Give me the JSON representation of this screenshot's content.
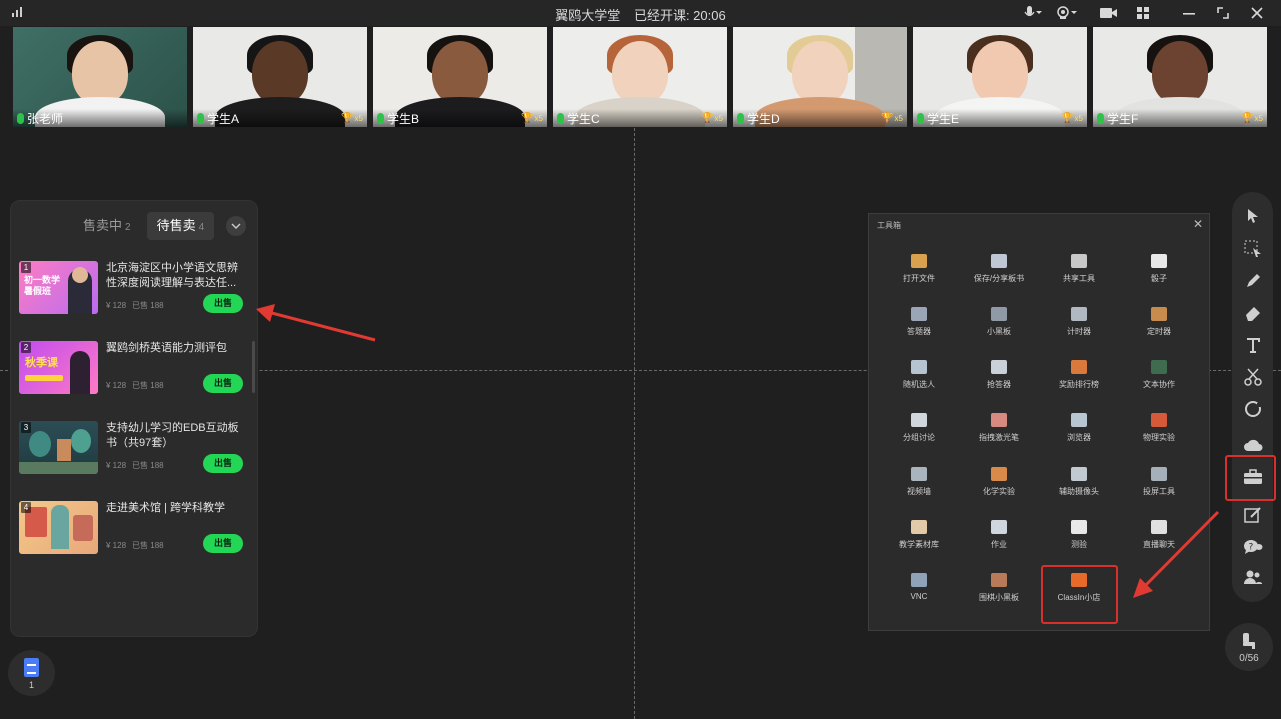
{
  "topbar": {
    "title": "翼鸥大学堂",
    "status": "已经开课: 20:06",
    "icons": [
      "signal-icon",
      "microphone-icon",
      "camera-select-icon",
      "video-icon",
      "layout-grid-icon",
      "minimize-icon",
      "restore-icon",
      "close-icon"
    ]
  },
  "videos": [
    {
      "name": "张老师",
      "trophy": ""
    },
    {
      "name": "学生A",
      "trophy": "x5"
    },
    {
      "name": "学生B",
      "trophy": "x5"
    },
    {
      "name": "学生C",
      "trophy": "x5"
    },
    {
      "name": "学生D",
      "trophy": "x5"
    },
    {
      "name": "学生E",
      "trophy": "x5"
    },
    {
      "name": "学生F",
      "trophy": "x5"
    }
  ],
  "shop": {
    "tabs": [
      {
        "label": "售卖中",
        "count": "2"
      },
      {
        "label": "待售卖",
        "count": "4"
      }
    ],
    "items": [
      {
        "index": "1",
        "title": "北京海淀区中小学语文思辨性深度阅读理解与表达任...",
        "price": "¥ 128",
        "sold": "已售 188",
        "button": "出售",
        "thumb_text": "初一数学 暑假班"
      },
      {
        "index": "2",
        "title": "翼鸥剑桥英语能力测评包",
        "price": "¥ 128",
        "sold": "已售 188",
        "button": "出售",
        "thumb_text": "秋季课"
      },
      {
        "index": "3",
        "title": "支持幼儿学习的EDB互动板书（共97套）",
        "price": "¥ 128",
        "sold": "已售 188",
        "button": "出售",
        "thumb_text": ""
      },
      {
        "index": "4",
        "title": "走进美术馆 | 跨学科教学",
        "price": "¥ 128",
        "sold": "已售 188",
        "button": "出售",
        "thumb_text": ""
      }
    ]
  },
  "doc_button": {
    "count": "1"
  },
  "toolbox": {
    "title": "工具箱",
    "close": "✕",
    "tools": [
      {
        "label": "打开文件",
        "icon": "folder-icon",
        "color": "#d9a04e"
      },
      {
        "label": "保存/分享板书",
        "icon": "save-icon",
        "color": "#bfc7d4"
      },
      {
        "label": "共享工具",
        "icon": "share-screen-icon",
        "color": "#c8c8c8"
      },
      {
        "label": "骰子",
        "icon": "dice-icon",
        "color": "#e8e8e8"
      },
      {
        "label": "答题器",
        "icon": "answer-icon",
        "color": "#9aa6b5"
      },
      {
        "label": "小黑板",
        "icon": "blackboard-icon",
        "color": "#8f9aa6"
      },
      {
        "label": "计时器",
        "icon": "stopwatch-icon",
        "color": "#b0b8c2"
      },
      {
        "label": "定时器",
        "icon": "hourglass-icon",
        "color": "#c78b4e"
      },
      {
        "label": "随机选人",
        "icon": "random-pick-icon",
        "color": "#b5c4d0"
      },
      {
        "label": "抢答器",
        "icon": "buzzer-icon",
        "color": "#c9d0d8"
      },
      {
        "label": "奖励排行榜",
        "icon": "leaderboard-icon",
        "color": "#d97a3c"
      },
      {
        "label": "文本协作",
        "icon": "text-collab-icon",
        "color": "#3f6b4e"
      },
      {
        "label": "分组讨论",
        "icon": "group-discuss-icon",
        "color": "#d0d6dc"
      },
      {
        "label": "指拽激光笔",
        "icon": "laser-pointer-icon",
        "color": "#d98a80"
      },
      {
        "label": "浏览器",
        "icon": "browser-icon",
        "color": "#b8c6d2"
      },
      {
        "label": "物理实验",
        "icon": "magnet-icon",
        "color": "#d65a3a"
      },
      {
        "label": "视频墙",
        "icon": "video-wall-icon",
        "color": "#aab4be"
      },
      {
        "label": "化学实验",
        "icon": "flask-icon",
        "color": "#d88a4a"
      },
      {
        "label": "辅助摄像头",
        "icon": "aux-camera-icon",
        "color": "#c2c9d0"
      },
      {
        "label": "投屏工具",
        "icon": "cast-icon",
        "color": "#a6b0ba"
      },
      {
        "label": "教学素材库",
        "icon": "material-library-icon",
        "color": "#e2c9a8"
      },
      {
        "label": "作业",
        "icon": "homework-icon",
        "color": "#cfd6de"
      },
      {
        "label": "测验",
        "icon": "quiz-icon",
        "color": "#e8e8e8"
      },
      {
        "label": "直播聊天",
        "icon": "live-chat-icon",
        "color": "#e0e0e0"
      },
      {
        "label": "VNC",
        "icon": "vnc-icon",
        "color": "#8fa2b8"
      },
      {
        "label": "围棋小黑板",
        "icon": "go-board-icon",
        "color": "#b87a58"
      },
      {
        "label": "ClassIn小店",
        "icon": "shop-cart-icon",
        "color": "#e86a2a"
      }
    ]
  },
  "right_toolbar": {
    "items": [
      "select-arrow-icon",
      "area-select-icon",
      "pen-icon",
      "eraser-icon",
      "text-icon",
      "scissors-icon",
      "shape-icon",
      "cloud-icon",
      "toolbox-icon",
      "edit-icon",
      "question-chat-icon",
      "users-icon"
    ]
  },
  "seat_button": {
    "count": "0/56"
  }
}
